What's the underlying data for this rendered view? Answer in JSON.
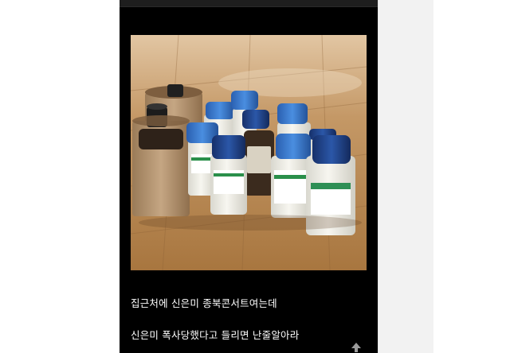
{
  "post": {
    "photo": {
      "subject": "reagent-bottles-on-wooden-floor",
      "colors": {
        "floor": "#b98c5a",
        "floor_dark": "#8d6236",
        "cap_blue": "#2f6fc4",
        "cap_navy": "#1d3f82",
        "bottle_white": "#efeee6",
        "cardboard": "#b59672",
        "amber_glass": "#3b2b1e"
      }
    },
    "caption_lines": [
      "집근처에 신은미 종북콘서트여는데",
      "신은미 폭사당했다고 들리면 난줄알아라"
    ]
  },
  "controls": {
    "scroll_top_icon": "arrow-up-icon"
  },
  "theme": {
    "post_background": "#000000",
    "sidebar_background": "#f2f2f2",
    "text_color": "#ffffff"
  }
}
